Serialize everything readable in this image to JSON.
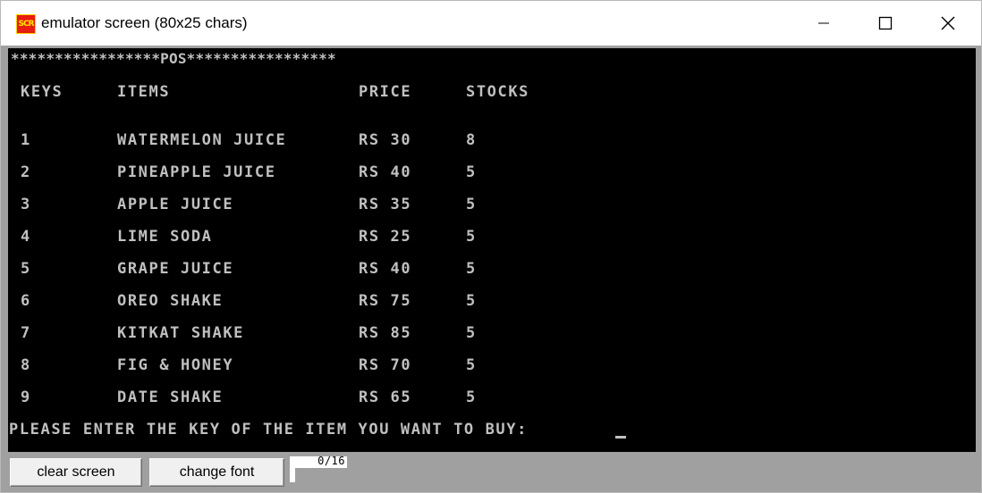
{
  "window": {
    "title": "emulator screen (80x25 chars)",
    "icon_name": "emulator-app-icon",
    "icon_text": "SCR"
  },
  "console": {
    "banner": "*****************POS*****************",
    "headers": {
      "keys": "KEYS",
      "items": "ITEMS",
      "price": "PRICE",
      "stocks": "STOCKS"
    },
    "rows": [
      {
        "key": "1",
        "item": "WATERMELON JUICE",
        "price": "RS 30",
        "stock": "8"
      },
      {
        "key": "2",
        "item": "PINEAPPLE JUICE",
        "price": "RS 40",
        "stock": "5"
      },
      {
        "key": "3",
        "item": "APPLE JUICE",
        "price": "RS 35",
        "stock": "5"
      },
      {
        "key": "4",
        "item": "LIME SODA",
        "price": "RS 25",
        "stock": "5"
      },
      {
        "key": "5",
        "item": "GRAPE JUICE",
        "price": "RS 40",
        "stock": "5"
      },
      {
        "key": "6",
        "item": "OREO SHAKE",
        "price": "RS 75",
        "stock": "5"
      },
      {
        "key": "7",
        "item": "KITKAT SHAKE",
        "price": "RS 85",
        "stock": "5"
      },
      {
        "key": "8",
        "item": "FIG & HONEY",
        "price": "RS 70",
        "stock": "5"
      },
      {
        "key": "9",
        "item": "DATE SHAKE",
        "price": "RS 65",
        "stock": "5"
      }
    ],
    "prompt": "PLEASE ENTER THE KEY OF THE ITEM YOU WANT TO BUY:"
  },
  "toolbar": {
    "clear_label": "clear screen",
    "font_label": "change font",
    "counter": "0/16"
  },
  "colors": {
    "console_bg": "#000000",
    "console_fg": "#c0c0c0",
    "frame_bg": "#a0a0a0",
    "icon_bg": "#e81c10",
    "icon_fg": "#ffe800"
  }
}
